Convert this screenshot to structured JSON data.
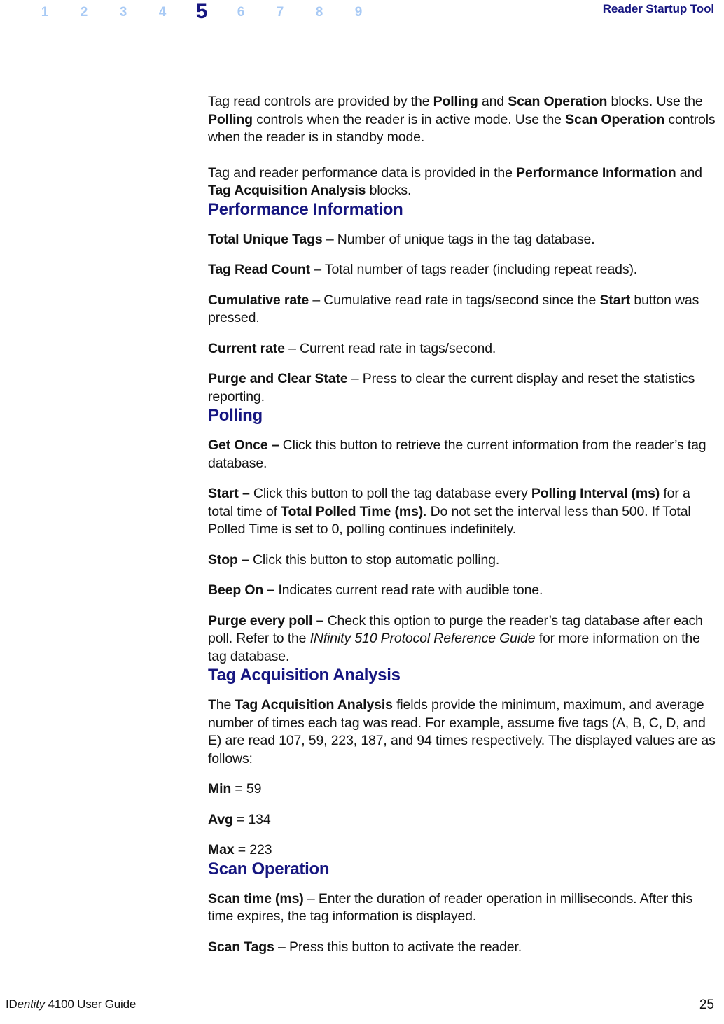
{
  "header": {
    "chapter_numbers": [
      "1",
      "2",
      "3",
      "4",
      "5",
      "6",
      "7",
      "8",
      "9"
    ],
    "current_chapter": "5",
    "title": "Reader Startup Tool",
    "accent_color": "#161680",
    "inactive_color": "#a8caf5"
  },
  "footer": {
    "guide_name_prefix": "ID",
    "guide_name_italic": "entity",
    "guide_name_suffix": " 4100 User Guide",
    "page_number": "25"
  },
  "content": {
    "intro": {
      "p1": {
        "s1": "Tag read controls are provided by the ",
        "b1": "Polling",
        "s2": " and ",
        "b2": "Scan Operation",
        "s3": " blocks. Use the ",
        "b3": "Polling",
        "s4": " controls when the reader is in active mode. Use the ",
        "b4": "Scan Operation",
        "s5": " controls when the reader is in standby mode."
      },
      "p2": {
        "s1": "Tag and reader performance data is provided in the ",
        "b1": "Performance Information",
        "s2": " and ",
        "b2": "Tag Acquisition Analysis",
        "s3": " blocks."
      }
    },
    "performance_information": {
      "heading": "Performance Information",
      "items": [
        {
          "term": "Total Unique Tags",
          "dash": " – ",
          "desc": "Number of unique tags in the tag database."
        },
        {
          "term": "Tag Read Count",
          "dash": " – ",
          "desc": "Total number of tags reader (including repeat reads)."
        },
        {
          "term": "Cumulative rate",
          "dash": " – ",
          "desc_a": "Cumulative read rate in tags/second since the ",
          "desc_b": "Start",
          "desc_c": " button was pressed."
        },
        {
          "term": "Current rate",
          "dash": " – ",
          "desc": "Current read rate in tags/second."
        },
        {
          "term": "Purge and Clear State",
          "dash": " – ",
          "desc": "Press to clear the current display and reset the statistics reporting."
        }
      ]
    },
    "polling": {
      "heading": "Polling",
      "items": [
        {
          "term": "Get Once –",
          "desc": " Click this button to retrieve the current information from the reader’s tag database."
        },
        {
          "term": "Start –",
          "desc_a": " Click this button to poll the tag database every ",
          "desc_b": "Polling Interval (ms)",
          "desc_c": " for a total time of ",
          "desc_d": "Total Polled Time (ms)",
          "desc_e": ". Do not set the interval less than 500. If Total Polled Time is set to 0, polling continues indefinitely."
        },
        {
          "term": "Stop –",
          "desc": " Click this button to stop automatic polling."
        },
        {
          "term": "Beep On –",
          "desc": " Indicates current read rate with audible tone."
        },
        {
          "term": "Purge every poll –",
          "desc_a": " Check this option to purge the reader’s tag database after each poll. Refer to the ",
          "desc_italic": "INfinity 510 Protocol Reference Guide",
          "desc_b": " for more information on the tag database."
        }
      ]
    },
    "tag_acquisition_analysis": {
      "heading": "Tag Acquisition Analysis",
      "paragraph": {
        "s1": "The ",
        "b1": "Tag Acquisition Analysis",
        "s2": " fields provide the minimum, maximum, and average number of times each tag was read. For example, assume five tags (A, B, C, D, and E) are read 107, 59, 223, 187, and 94 times respectively. The displayed values are as follows:"
      },
      "values": [
        {
          "label": "Min",
          "value": " = 59"
        },
        {
          "label": "Avg",
          "value": " = 134"
        },
        {
          "label": "Max",
          "value": " = 223"
        }
      ]
    },
    "scan_operation": {
      "heading": "Scan Operation",
      "items": [
        {
          "term": "Scan time (ms)",
          "dash": " – ",
          "desc": "Enter the duration of reader operation in milliseconds. After this time expires, the tag information is displayed."
        },
        {
          "term": "Scan Tags",
          "dash": " – ",
          "desc": "Press this button to activate the reader."
        }
      ]
    }
  }
}
